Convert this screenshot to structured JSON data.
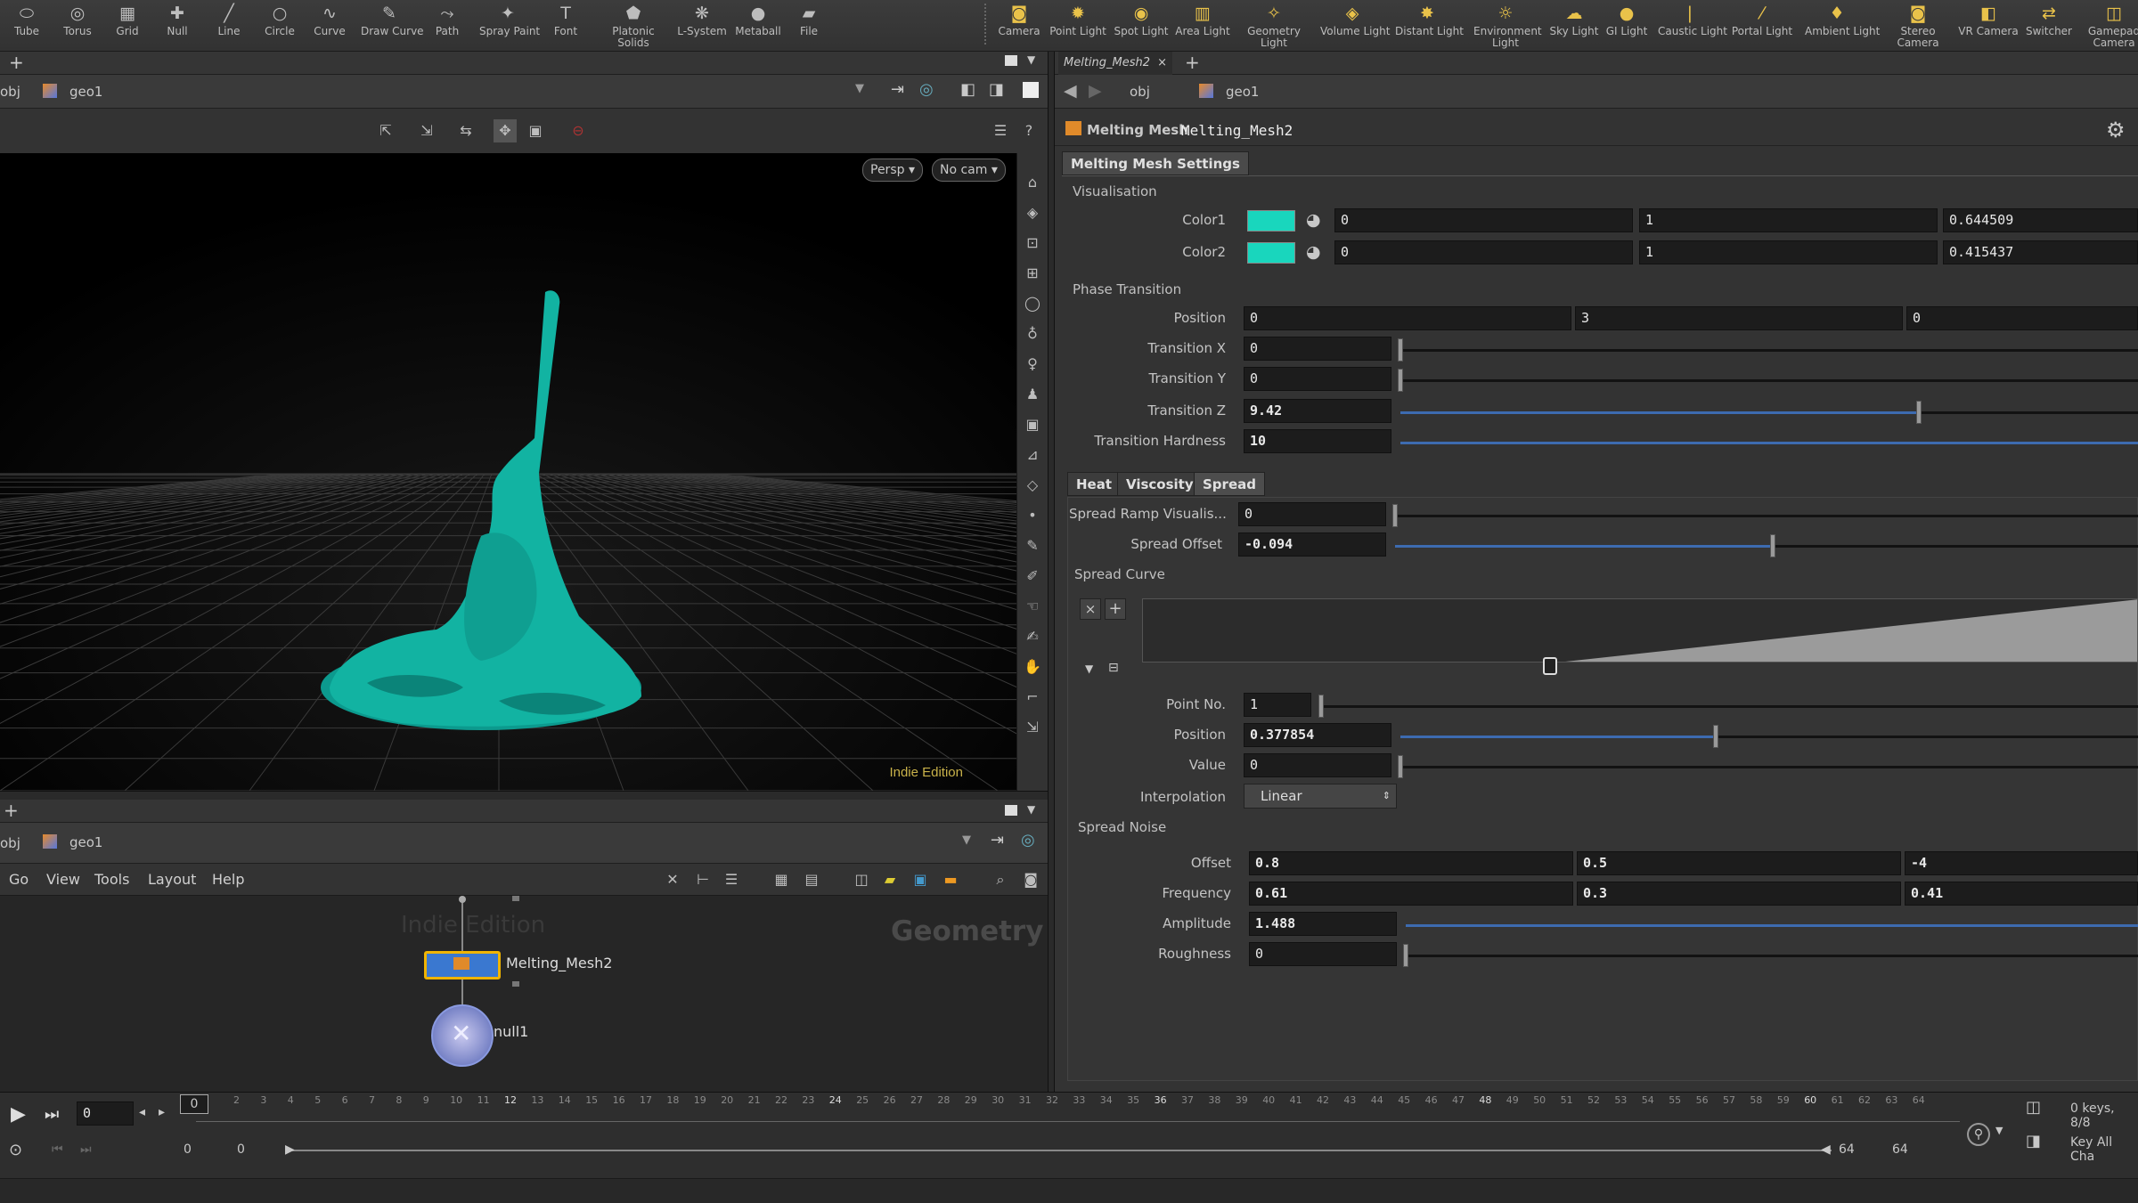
{
  "shelf": {
    "left": [
      {
        "label": "Tube",
        "icon": "⬭",
        "name": "tube-tool"
      },
      {
        "label": "Torus",
        "icon": "◎",
        "name": "torus-tool"
      },
      {
        "label": "Grid",
        "icon": "▦",
        "name": "grid-tool"
      },
      {
        "label": "Null",
        "icon": "✚",
        "name": "null-tool"
      },
      {
        "label": "Line",
        "icon": "╱",
        "name": "line-tool"
      },
      {
        "label": "Circle",
        "icon": "○",
        "name": "circle-tool"
      },
      {
        "label": "Curve",
        "icon": "∿",
        "name": "curve-tool"
      },
      {
        "label": "Draw Curve",
        "icon": "✎",
        "name": "draw-curve-tool"
      },
      {
        "label": "Path",
        "icon": "⤳",
        "name": "path-tool"
      },
      {
        "label": "Spray Paint",
        "icon": "✦",
        "name": "spray-paint-tool"
      },
      {
        "label": "Font",
        "icon": "T",
        "name": "font-tool"
      },
      {
        "label": "Platonic\nSolids",
        "icon": "⬟",
        "name": "platonic-solids-tool"
      },
      {
        "label": "L-System",
        "icon": "❋",
        "name": "l-system-tool"
      },
      {
        "label": "Metaball",
        "icon": "●",
        "name": "metaball-tool"
      },
      {
        "label": "File",
        "icon": "▰",
        "name": "file-tool"
      }
    ],
    "right": [
      {
        "label": "Camera",
        "icon": "◙",
        "name": "camera-tool"
      },
      {
        "label": "Point Light",
        "icon": "✹",
        "name": "point-light-tool"
      },
      {
        "label": "Spot Light",
        "icon": "◉",
        "name": "spot-light-tool"
      },
      {
        "label": "Area Light",
        "icon": "▥",
        "name": "area-light-tool"
      },
      {
        "label": "Geometry\nLight",
        "icon": "✧",
        "name": "geometry-light-tool"
      },
      {
        "label": "Volume Light",
        "icon": "◈",
        "name": "volume-light-tool"
      },
      {
        "label": "Distant Light",
        "icon": "✸",
        "name": "distant-light-tool"
      },
      {
        "label": "Environment\nLight",
        "icon": "☼",
        "name": "environment-light-tool"
      },
      {
        "label": "Sky Light",
        "icon": "☁",
        "name": "sky-light-tool"
      },
      {
        "label": "GI Light",
        "icon": "●",
        "name": "gi-light-tool"
      },
      {
        "label": "Caustic Light",
        "icon": "❘",
        "name": "caustic-light-tool"
      },
      {
        "label": "Portal Light",
        "icon": "⁄",
        "name": "portal-light-tool"
      },
      {
        "label": "Ambient Light",
        "icon": "♦",
        "name": "ambient-light-tool"
      },
      {
        "label": "Stereo\nCamera",
        "icon": "◙",
        "name": "stereo-camera-tool"
      },
      {
        "label": "VR Camera",
        "icon": "◧",
        "name": "vr-camera-tool"
      },
      {
        "label": "Switcher",
        "icon": "⇄",
        "name": "switcher-tool"
      },
      {
        "label": "Gamepad\nCamera",
        "icon": "◫",
        "name": "gamepad-camera-tool"
      }
    ]
  },
  "viewer": {
    "path_root": "obj",
    "path_node": "geo1",
    "persp": "Persp ▾",
    "cam": "No cam ▾",
    "watermark": "Indie Edition"
  },
  "network": {
    "path_root": "obj",
    "path_node": "geo1",
    "menu": [
      "Go",
      "View",
      "Tools",
      "Layout",
      "Help"
    ],
    "watermark_edition": "Indie Edition",
    "context_label": "Geometry",
    "node1": "Melting_Mesh2",
    "node2": "null1"
  },
  "params": {
    "tab_title": "Melting_Mesh2",
    "path_root": "obj",
    "path_node": "geo1",
    "node_type": "Melting Mesh",
    "node_name": "Melting_Mesh2",
    "folder_tab": "Melting Mesh Settings",
    "visualisation_label": "Visualisation",
    "color1_label": "Color1",
    "color1": [
      "0",
      "1",
      "0.644509"
    ],
    "color2_label": "Color2",
    "color2": [
      "0",
      "1",
      "0.415437"
    ],
    "swatch_color": "#19d6bd",
    "phase_label": "Phase Transition",
    "position_label": "Position",
    "position": [
      "0",
      "3",
      "0"
    ],
    "tx_label": "Transition X",
    "tx": "0",
    "ty_label": "Transition Y",
    "ty": "0",
    "tz_label": "Transition Z",
    "tz": "9.42",
    "th_label": "Transition Hardness",
    "th": "10",
    "subtabs": [
      "Heat",
      "Viscosity",
      "Spread"
    ],
    "srv_label": "Spread Ramp Visualis...",
    "srv": "0",
    "soff_label": "Spread Offset",
    "soff": "-0.094",
    "curve_label": "Spread Curve",
    "pointno_label": "Point No.",
    "pointno": "1",
    "rpos_label": "Position",
    "rpos": "0.377854",
    "rval_label": "Value",
    "rval": "0",
    "interp_label": "Interpolation",
    "interp": "Linear",
    "noise_label": "Spread Noise",
    "offset_label": "Offset",
    "offset": [
      "0.8",
      "0.5",
      "-4"
    ],
    "freq_label": "Frequency",
    "freq": [
      "0.61",
      "0.3",
      "0.41"
    ],
    "amp_label": "Amplitude",
    "amp": "1.488",
    "rough_label": "Roughness",
    "rough": "0"
  },
  "timeline": {
    "frame": "0",
    "start": "0",
    "start2": "0",
    "end": "64",
    "end2": "64",
    "current_marker": "0",
    "keys_info": "0 keys, 8/8",
    "key_all": "Key All Cha",
    "ruler": [
      "2",
      "3",
      "4",
      "5",
      "6",
      "7",
      "8",
      "9",
      "10",
      "11",
      "12",
      "13",
      "14",
      "15",
      "16",
      "17",
      "18",
      "19",
      "20",
      "21",
      "22",
      "23",
      "24",
      "25",
      "26",
      "27",
      "28",
      "29",
      "30",
      "31",
      "32",
      "33",
      "34",
      "35",
      "36",
      "37",
      "38",
      "39",
      "40",
      "41",
      "42",
      "43",
      "44",
      "45",
      "46",
      "47",
      "48",
      "49",
      "50",
      "51",
      "52",
      "53",
      "54",
      "55",
      "56",
      "57",
      "58",
      "59",
      "60",
      "61",
      "62",
      "63",
      "64"
    ]
  }
}
